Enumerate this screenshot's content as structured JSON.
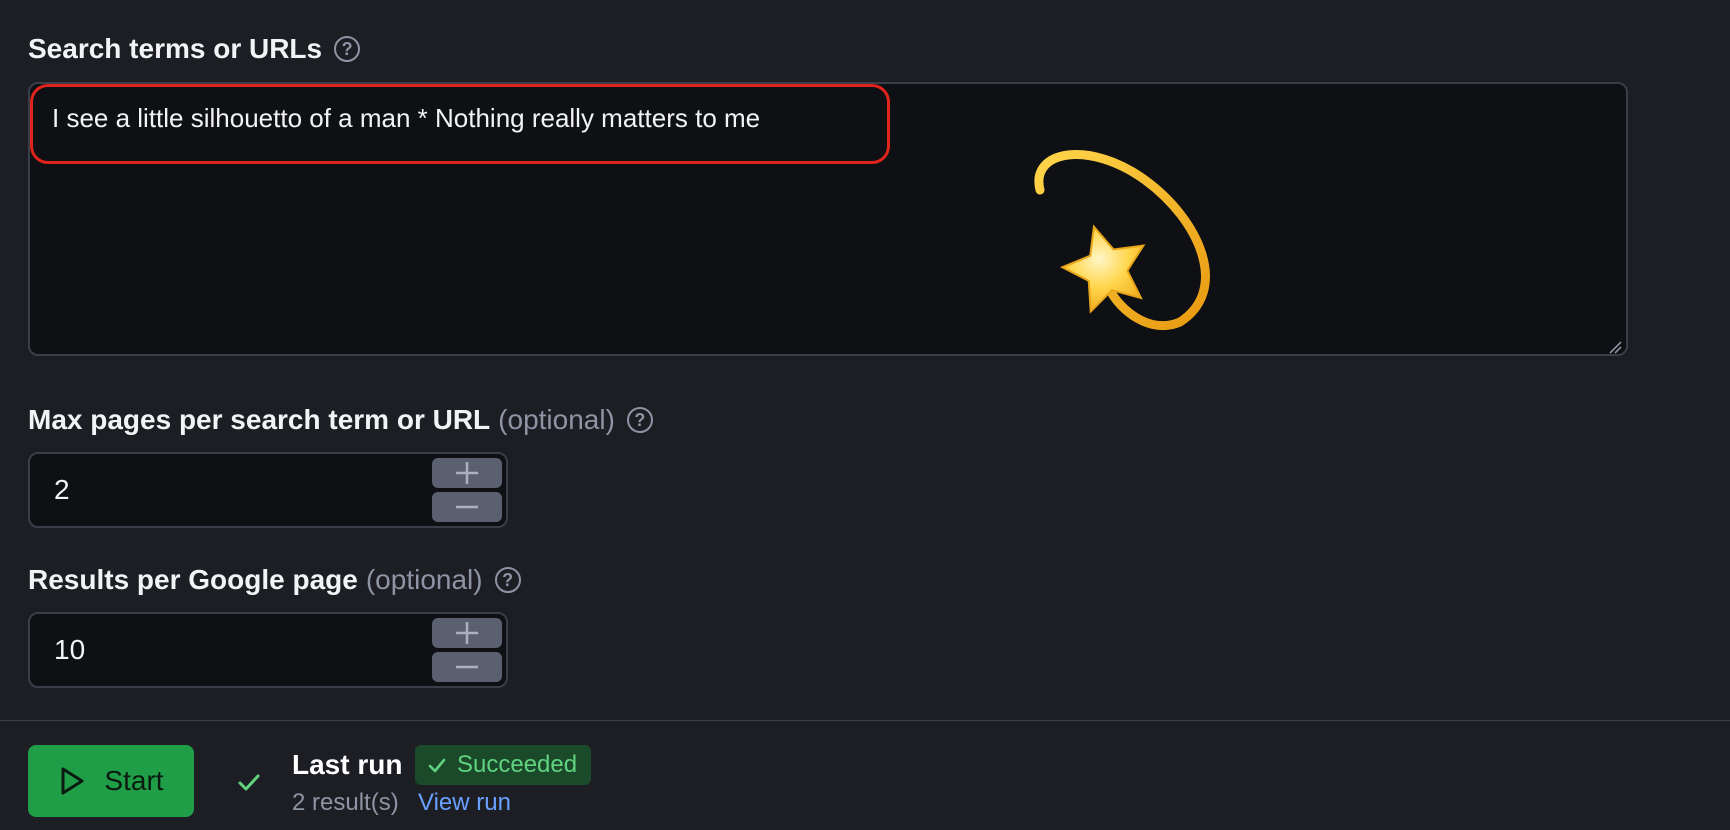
{
  "search_terms": {
    "label": "Search terms or URLs",
    "value": "I see a little silhouetto of a man * Nothing really matters to me"
  },
  "max_pages": {
    "label": "Max pages per search term or URL",
    "optional_label": "(optional)",
    "value": "2"
  },
  "results_per_page": {
    "label": "Results per Google page",
    "optional_label": "(optional)",
    "value": "10"
  },
  "footer": {
    "start_label": "Start",
    "last_run_label": "Last run",
    "status": "Succeeded",
    "results_count": "2 result(s)",
    "view_run_label": "View run"
  },
  "icons": {
    "help": "help-circle-icon",
    "plus": "plus-icon",
    "minus": "minus-icon",
    "play": "play-icon",
    "check": "check-icon",
    "sparkle": "dizzy-star-icon"
  },
  "colors": {
    "background": "#1c1e24",
    "input_background": "#0f1014",
    "accent_green": "#1f9d47",
    "status_green": "#5fd37f",
    "link_blue": "#6aa0ff",
    "highlight_red": "#e0241b"
  }
}
